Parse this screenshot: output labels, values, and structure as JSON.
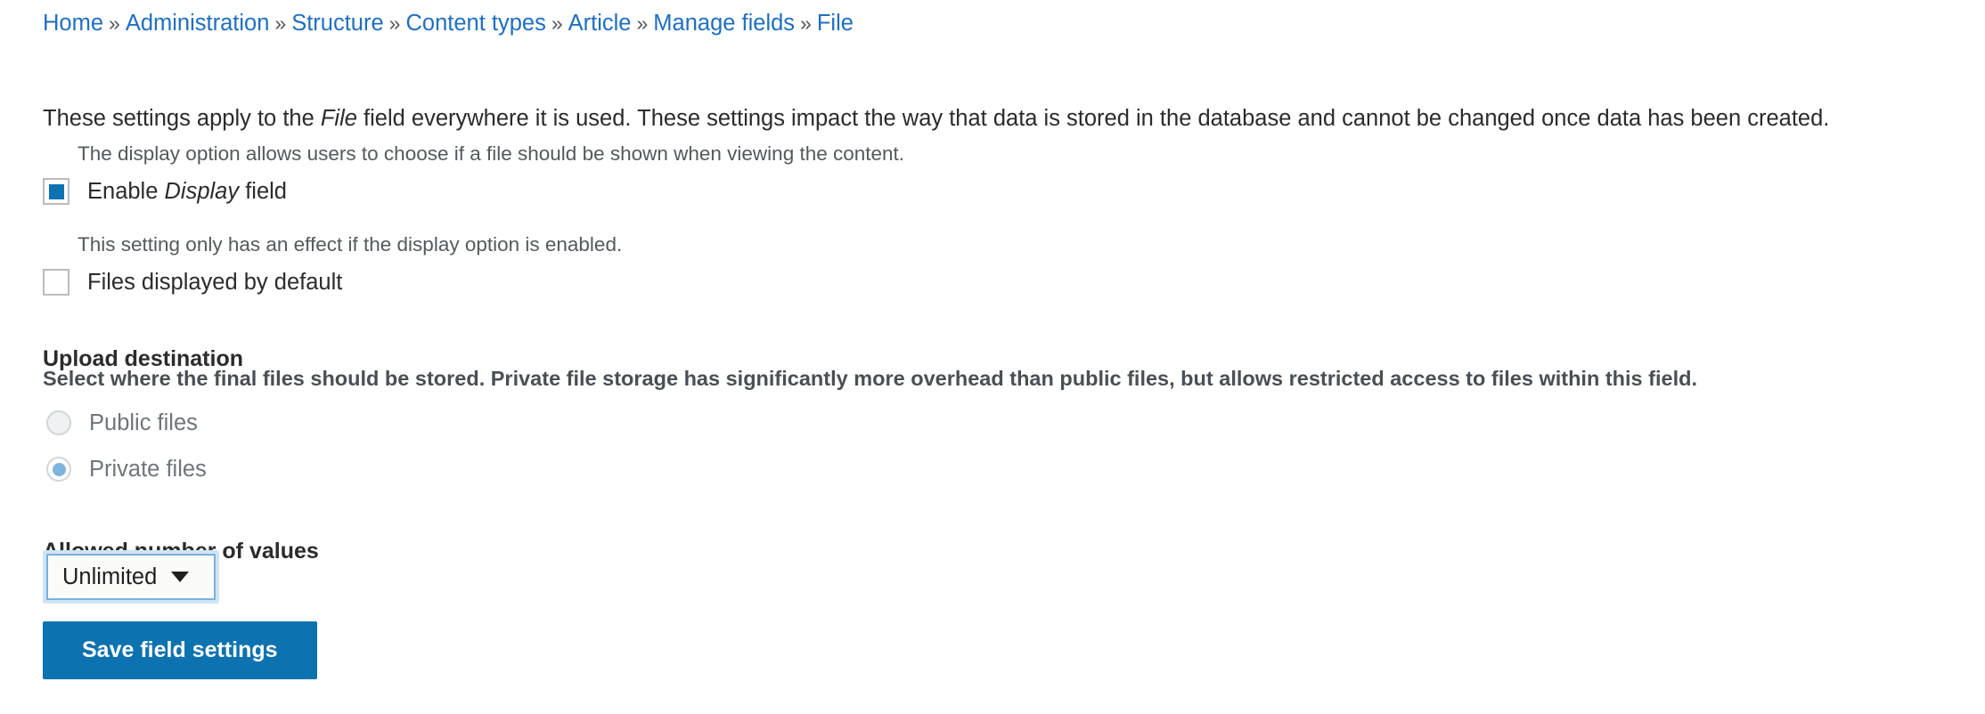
{
  "breadcrumb": {
    "separator": "»",
    "items": [
      {
        "label": "Home"
      },
      {
        "label": "Administration"
      },
      {
        "label": "Structure"
      },
      {
        "label": "Content types"
      },
      {
        "label": "Article"
      },
      {
        "label": "Manage fields"
      },
      {
        "label": "File"
      }
    ]
  },
  "intro": {
    "before_em": "These settings apply to the ",
    "em": "File",
    "after_em": " field everywhere it is used. These settings impact the way that data is stored in the database and cannot be changed once data has been created."
  },
  "display_field": {
    "description": "The display option allows users to choose if a file should be shown when viewing the content.",
    "label_before_em": "Enable ",
    "label_em": "Display",
    "label_after_em": " field",
    "checked": true
  },
  "files_displayed": {
    "description": "This setting only has an effect if the display option is enabled.",
    "label": "Files displayed by default",
    "checked": false
  },
  "upload_destination": {
    "title": "Upload destination",
    "description": "Select where the final files should be stored. Private file storage has significantly more overhead than public files, but allows restricted access to files within this field.",
    "options": [
      {
        "label": "Public files",
        "selected": false
      },
      {
        "label": "Private files",
        "selected": true
      }
    ]
  },
  "allowed_number_of_values": {
    "title": "Allowed number of values",
    "selected": "Unlimited"
  },
  "actions": {
    "save_label": "Save field settings"
  },
  "colors": {
    "link": "#1f6fc0",
    "accent": "#0c72b0",
    "radio_dot": "#7cb4dd",
    "focus_ring": "#cfe4f4",
    "text": "#2b2b2b",
    "muted_text": "#55595c"
  }
}
